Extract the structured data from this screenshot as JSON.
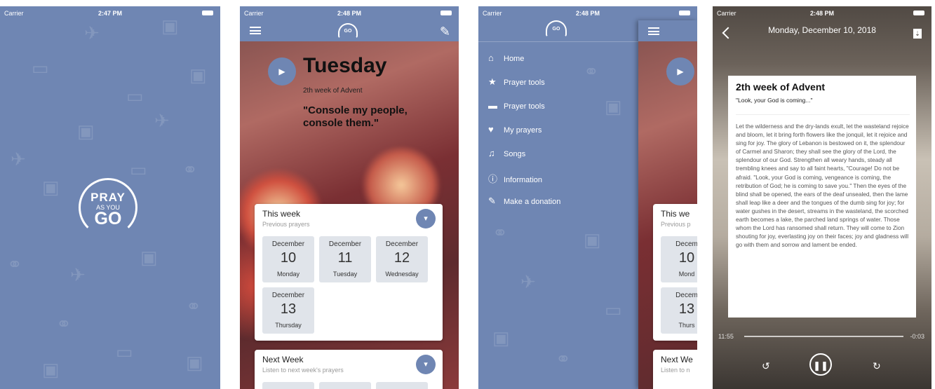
{
  "status": {
    "carrier": "Carrier",
    "time1": "2:47 PM",
    "time2": "2:48 PM",
    "time3": "2:48 PM",
    "time4": "2:48 PM"
  },
  "splash": {
    "logo_top": "PRAY",
    "logo_mid": "AS YOU",
    "logo_bottom": "GO"
  },
  "home": {
    "nav_logo": "GO",
    "day": "Tuesday",
    "week": "2th week of Advent",
    "quote": "\"Console my people, console them.\"",
    "this_week": {
      "title": "This week",
      "subtitle": "Previous prayers"
    },
    "next_week": {
      "title": "Next Week",
      "subtitle": "Listen to next week's prayers"
    },
    "days": [
      {
        "month": "December",
        "date": "10",
        "weekday": "Monday"
      },
      {
        "month": "December",
        "date": "11",
        "weekday": "Tuesday"
      },
      {
        "month": "December",
        "date": "12",
        "weekday": "Wednesday"
      },
      {
        "month": "December",
        "date": "13",
        "weekday": "Thursday"
      }
    ]
  },
  "menu": {
    "items": [
      {
        "label": "Home",
        "icon": "home-icon"
      },
      {
        "label": "Prayer tools",
        "icon": "star-icon"
      },
      {
        "label": "Prayer tools",
        "icon": "briefcase-icon"
      },
      {
        "label": "My prayers",
        "icon": "heart-icon"
      },
      {
        "label": "Songs",
        "icon": "music-note-icon"
      },
      {
        "label": "Information",
        "icon": "info-icon"
      },
      {
        "label": "Make a donation",
        "icon": "donation-icon"
      }
    ],
    "peek_title": "This we",
    "peek_sub": "Previous p",
    "peek_next": "Next We",
    "peek_next_sub": "Listen to n",
    "peek_tiles": [
      {
        "month": "Decem",
        "date": "10",
        "weekday": "Mond"
      },
      {
        "month": "Decem",
        "date": "13",
        "weekday": "Thurs"
      }
    ]
  },
  "reader": {
    "date": "Monday, December 10, 2018",
    "title": "2th week of Advent",
    "subtitle": "\"Look, your God is coming...\"",
    "body": "Let the wilderness and the dry-lands exult, let the wasteland rejoice and bloom, let it bring forth flowers like the jonquil, let it rejoice and sing for joy. The glory of Lebanon is bestowed on it, the splendour of Carmel and Sharon; they shall see the glory of the Lord, the splendour of our God. Strengthen all weary hands, steady all trembling knees and say to all faint hearts, \"Courage! Do not be afraid. \"Look, your God is coming, vengeance is coming, the retribution of God; he is coming to save you.\" Then the eyes of the blind shall be opened, the ears of the deaf unsealed, then the lame shall leap like a deer and the tongues of the dumb sing for joy; for water gushes in the desert, streams in the wasteland, the scorched earth becomes a lake, the parched land springs of water. Those whom the Lord has ransomed shall return. They will come to Zion shouting for joy, everlasting joy on their faces; joy and gladness will go with them and sorrow and lament be ended.",
    "elapsed": "11:55",
    "remaining": "-0:03"
  }
}
